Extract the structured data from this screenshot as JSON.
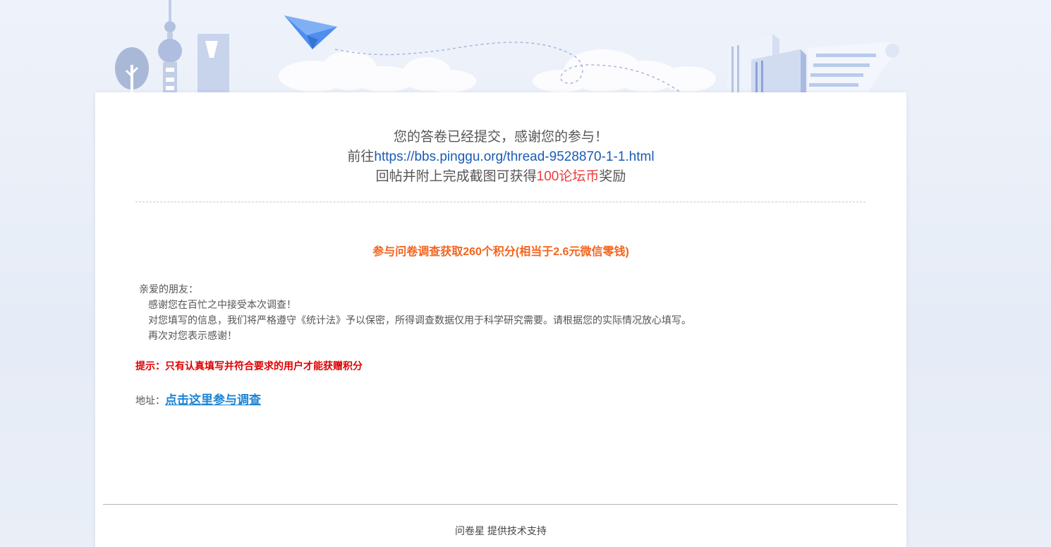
{
  "message": {
    "line1": "您的答卷已经提交，感谢您的参与！",
    "line2_prefix": "前往",
    "line2_link": "https://bbs.pinggu.org/thread-9528870-1-1.html",
    "line3_prefix": "回帖并附上完成截图可获得",
    "line3_reward": "100论坛币",
    "line3_suffix": "奖励"
  },
  "headline": "参与问卷调查获取260个积分(相当于2.6元微信零钱)",
  "greeting": {
    "salutation": "亲爱的朋友：",
    "line1": "感谢您在百忙之中接受本次调查！",
    "line2": "对您填写的信息，我们将严格遵守《统计法》予以保密，所得调查数据仅用于科学研究需要。请根据您的实际情况放心填写。",
    "line3": "再次对您表示感谢！"
  },
  "tip": "提示：只有认真填写并符合要求的用户才能获赠积分",
  "address": {
    "label": "地址：",
    "link_text": "点击这里参与调查"
  },
  "footer": "问卷星 提供技术支持",
  "colors": {
    "accent_orange": "#f2641e",
    "tip_red": "#e00000",
    "link_blue": "#1a5bb5",
    "reward_red": "#ee3b3b"
  },
  "icons": [
    "tree-illustration",
    "tv-tower-illustration",
    "skyscraper-illustration",
    "paper-plane-icon",
    "books-illustration",
    "scroll-illustration",
    "cloud-illustration"
  ]
}
